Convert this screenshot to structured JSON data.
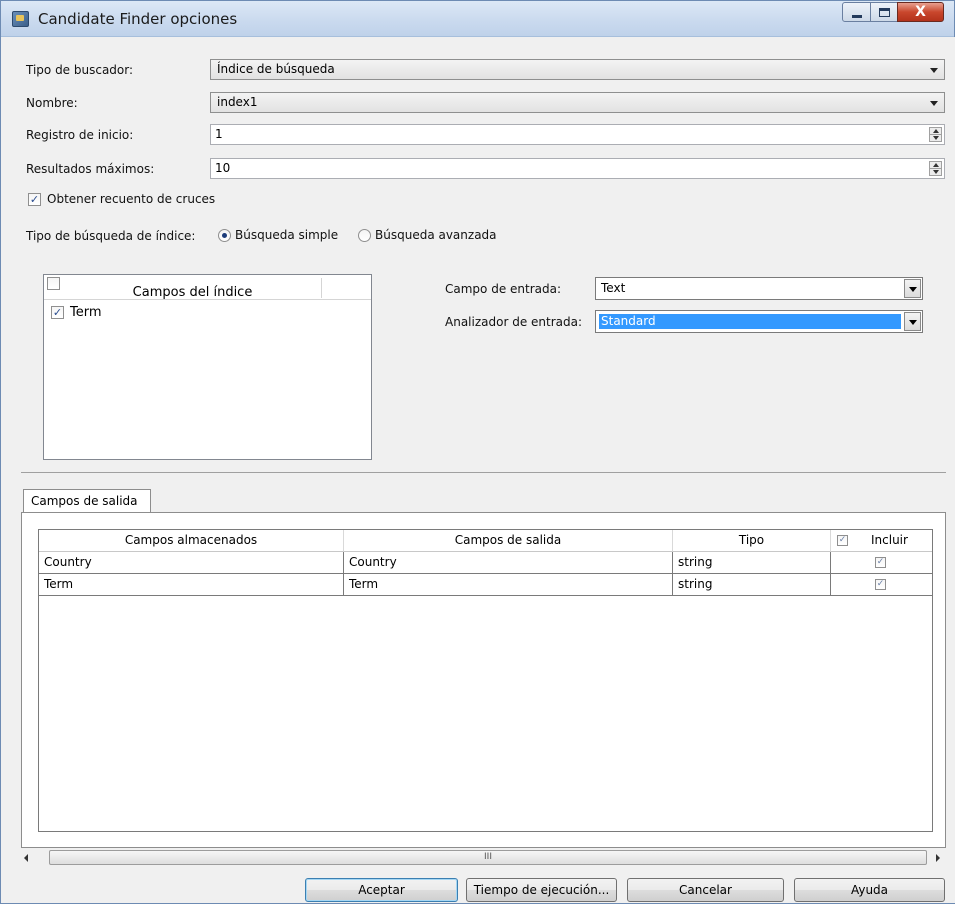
{
  "window": {
    "title": "Candidate Finder opciones",
    "close_glyph": "X"
  },
  "form": {
    "search_type": {
      "label": "Tipo de buscador:",
      "value": "Índice de búsqueda"
    },
    "name": {
      "label": "Nombre:",
      "value": "index1"
    },
    "start_record": {
      "label": "Registro de inicio:",
      "value": "1"
    },
    "max_results": {
      "label": "Resultados máximos:",
      "value": "10"
    },
    "get_hit_count": {
      "label": "Obtener recuento de cruces",
      "checked": true
    },
    "index_search_type": {
      "label": "Tipo de búsqueda de índice:",
      "options": [
        "Búsqueda simple",
        "Búsqueda avanzada"
      ],
      "selected": "Búsqueda simple"
    }
  },
  "index_fields": {
    "header": "Campos del índice",
    "items": [
      {
        "label": "Term",
        "checked": true
      }
    ]
  },
  "input": {
    "field": {
      "label": "Campo de entrada:",
      "value": "Text"
    },
    "analyzer": {
      "label": "Analizador de entrada:",
      "value": "Standard"
    }
  },
  "output_tab": {
    "tab_label": "Campos de salida",
    "columns": [
      "Campos almacenados",
      "Campos de salida",
      "Tipo",
      "Incluir"
    ],
    "rows": [
      {
        "stored": "Country",
        "output": "Country",
        "type": "string",
        "include": true
      },
      {
        "stored": "Term",
        "output": "Term",
        "type": "string",
        "include": true
      }
    ]
  },
  "scrollbar": {
    "grip": "III"
  },
  "buttons": {
    "ok": "Aceptar",
    "runtime": "Tiempo de ejecución...",
    "cancel": "Cancelar",
    "help": "Ayuda"
  },
  "colors": {
    "selection": "#3399ff",
    "check": "#2a4d8f"
  }
}
